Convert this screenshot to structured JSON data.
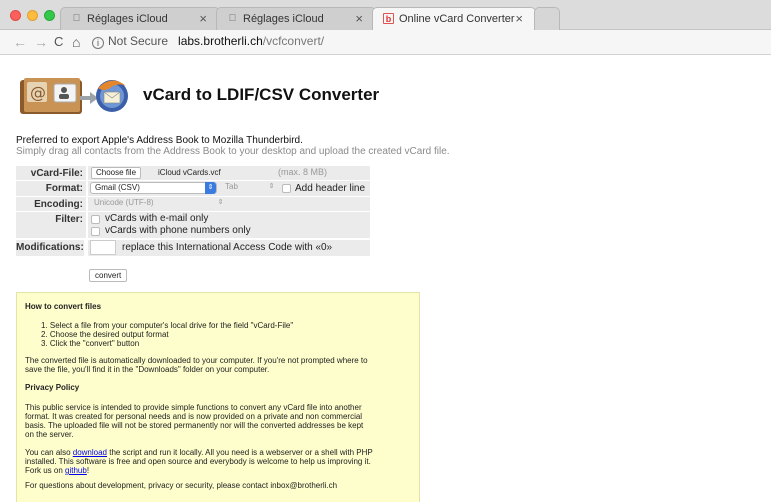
{
  "browser": {
    "tabs": [
      {
        "title": "Réglages iCloud",
        "active": false,
        "icon": "apple-icon"
      },
      {
        "title": "Réglages iCloud",
        "active": false,
        "icon": "apple-icon"
      },
      {
        "title": "Online vCard Converter",
        "active": true,
        "icon": "brotherli-icon"
      }
    ],
    "tab_close": "×",
    "nav": {
      "back": "←",
      "forward": "→",
      "reload": "C",
      "home": "⌂"
    },
    "security_label": "Not Secure",
    "url_host": "labs.brotherli.ch",
    "url_path": "/vcfconvert/"
  },
  "page": {
    "title": "vCard to LDIF/CSV Converter",
    "intro_line1": "Preferred to export Apple's Address Book to Mozilla Thunderbird.",
    "intro_line2": "Simply drag all contacts from the Address Book to your desktop and upload the created vCard file."
  },
  "form": {
    "vcard_file_label": "vCard-File:",
    "choose_file_button": "Choose file",
    "file_name": "iCloud vCards.vcf",
    "max_hint": "(max. 8 MB)",
    "format_label": "Format:",
    "format_value": "Gmail (CSV)",
    "delimiter_value": "Tab",
    "add_header_label": "Add header line",
    "encoding_label": "Encoding:",
    "encoding_value": "Unicode (UTF-8)",
    "filter_label": "Filter:",
    "filter_email_label": "vCards with e-mail only",
    "filter_phone_label": "vCards with phone numbers only",
    "modifications_label": "Modifications:",
    "modifications_text": "replace this International Access Code with «0»",
    "convert_button": "convert"
  },
  "info": {
    "howto_heading": "How to convert files",
    "steps": [
      "1. Select a file from your computer's local drive for the field \"vCard-File\"",
      "2. Choose the desired output format",
      "3. Click the \"convert\" button"
    ],
    "download_note_1": "The converted file is automatically downloaded to your computer. If you're not prompted where to",
    "download_note_2": "save the file, you'll find it in the \"Downloads\" folder on your computer.",
    "privacy_heading": "Privacy Policy",
    "privacy_1": "This public service is intended to provide simple functions to convert any vCard file into another",
    "privacy_2": "format. It was created for personal needs and is now provided on a private and non commercial",
    "privacy_3": "basis. The uploaded file will not be stored permanently nor will the converted addresses be kept",
    "privacy_4": "on the server.",
    "also_prefix": "You can also ",
    "download_link": "download",
    "also_suffix": " the script and run it locally. All you need is a webserver or a shell with PHP",
    "also_2": "installed. This software is free and open source and everybody is welcome to help us improving it.",
    "fork_prefix": "Fork us on ",
    "github_link": "github",
    "fork_suffix": "!",
    "contact": "For questions about development, privacy or security, please contact inbox@brotherli.ch"
  },
  "colors": {
    "info_background": "#fefecc",
    "select_accent": "#3a7be0",
    "link": "#0000ee"
  }
}
